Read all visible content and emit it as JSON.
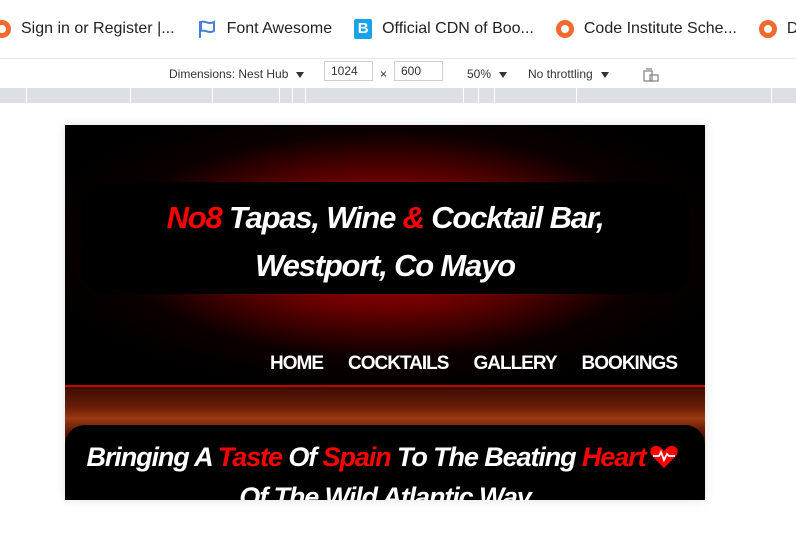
{
  "bookmarks": [
    {
      "label": "Sign in or Register |...",
      "icon": "orange-ring-icon"
    },
    {
      "label": "Font Awesome",
      "icon": "flag-icon"
    },
    {
      "label": "Official CDN of Boo...",
      "icon": "b-letter-icon"
    },
    {
      "label": "Code Institute Sche...",
      "icon": "orange-ring-icon"
    },
    {
      "label": "Dashboa",
      "icon": "orange-ring-icon"
    }
  ],
  "device_toolbar": {
    "dimensions_label": "Dimensions: Nest Hub",
    "width": "1024",
    "times": "×",
    "height": "600",
    "zoom": "50%",
    "throttling": "No throttling",
    "rotate_icon": "rotate-icon"
  },
  "site": {
    "title_part1": "No8",
    "title_part2": " Tapas, Wine ",
    "title_part3": "&",
    "title_part4": " Cocktail Bar, Westport, Co Mayo",
    "nav": [
      "HOME",
      "COCKTAILS",
      "GALLERY",
      "BOOKINGS"
    ],
    "tagline_a": "Bringing A ",
    "tagline_b": "Taste",
    "tagline_c": " Of ",
    "tagline_d": "Spain",
    "tagline_e": " To The Beating ",
    "tagline_f": "Heart",
    "tagline_g": " Of The Wild Atlantic Way"
  },
  "colors": {
    "accent_red": "#ff0000",
    "bookmark_orange": "#f26a2e",
    "bootstrap_blue": "#1aa3e8"
  }
}
